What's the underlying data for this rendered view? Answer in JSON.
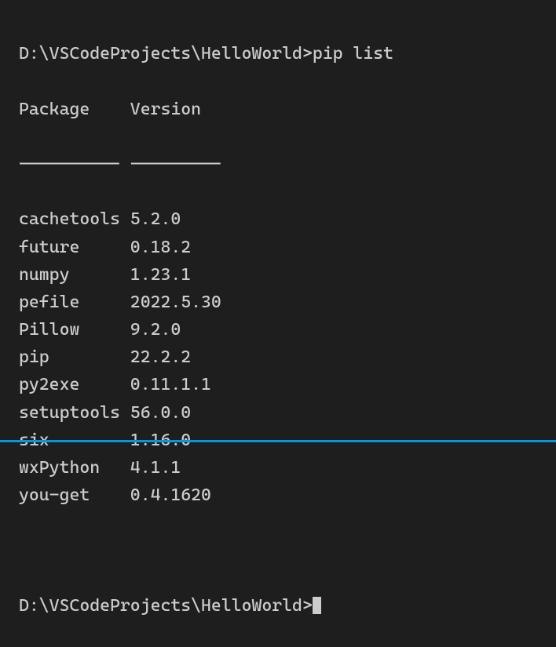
{
  "prompt1": {
    "path": "D:\\VSCodeProjects\\HelloWorld>",
    "command": "pip list"
  },
  "header": {
    "col1": "Package",
    "col2": "Version"
  },
  "separator": {
    "col1": "----------",
    "col2": "---------"
  },
  "packages": [
    {
      "name": "cachetools",
      "version": "5.2.0"
    },
    {
      "name": "future",
      "version": "0.18.2"
    },
    {
      "name": "numpy",
      "version": "1.23.1"
    },
    {
      "name": "pefile",
      "version": "2022.5.30"
    },
    {
      "name": "Pillow",
      "version": "9.2.0"
    },
    {
      "name": "pip",
      "version": "22.2.2"
    },
    {
      "name": "py2exe",
      "version": "0.11.1.1"
    },
    {
      "name": "setuptools",
      "version": "56.0.0"
    },
    {
      "name": "six",
      "version": "1.16.0"
    },
    {
      "name": "wxPython",
      "version": "4.1.1"
    },
    {
      "name": "you-get",
      "version": "0.4.1620"
    }
  ],
  "prompt2": {
    "path": "D:\\VSCodeProjects\\HelloWorld>"
  },
  "col1_width": 11
}
